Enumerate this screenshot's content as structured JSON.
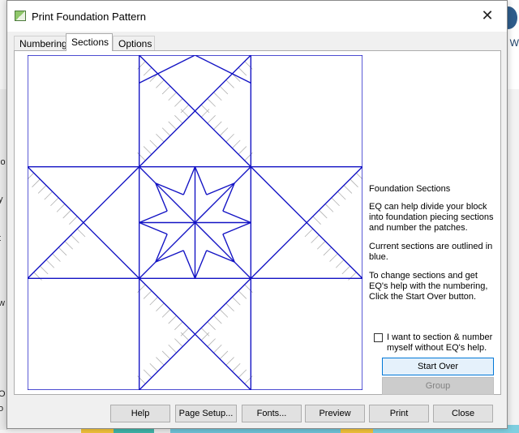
{
  "background": {
    "left_fragments": [
      "lo",
      "y",
      "t",
      "w",
      "O",
      "o"
    ],
    "right_text": "uilt W"
  },
  "dialog": {
    "title": "Print Foundation Pattern",
    "close_glyph": "✕",
    "tabs": [
      {
        "label": "Numbering",
        "active": false
      },
      {
        "label": "Sections",
        "active": true
      },
      {
        "label": "Options",
        "active": false
      }
    ],
    "side_panel": {
      "heading": "Foundation Sections",
      "para1": "EQ can help divide your block into foundation piecing sections and number the patches.",
      "para2": "Current sections are outlined in blue.",
      "para3": "To change sections and get EQ's help with the numbering, Click the Start Over button."
    },
    "manual_checkbox": {
      "label": "I want to section & number myself without EQ's help.",
      "checked": false
    },
    "start_over_label": "Start Over",
    "group_label": "Group",
    "bottom_buttons": {
      "help": "Help",
      "page_setup": "Page Setup...",
      "fonts": "Fonts...",
      "preview": "Preview",
      "print": "Print",
      "close": "Close"
    }
  },
  "colors": {
    "section_outline": "#1212c4",
    "patch_line": "#b0b0b0",
    "default_button_border": "#0078d7"
  }
}
